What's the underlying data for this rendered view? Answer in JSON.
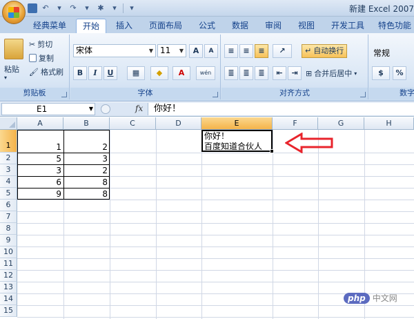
{
  "window": {
    "title": "新建 Excel 2007"
  },
  "tabs": [
    "经典菜单",
    "开始",
    "插入",
    "页面布局",
    "公式",
    "数据",
    "审阅",
    "视图",
    "开发工具",
    "特色功能"
  ],
  "active_tab": "开始",
  "ribbon": {
    "clipboard": {
      "paste": "粘贴",
      "cut": "剪切",
      "copy": "复制",
      "format_painter": "格式刷",
      "label": "剪贴板"
    },
    "font": {
      "name": "宋体",
      "size": "11",
      "label": "字体",
      "bold": "B",
      "italic": "I",
      "underline": "U",
      "grow": "A",
      "shrink": "A",
      "wen": "wén"
    },
    "alignment": {
      "wrap_text": "自动换行",
      "merge_center": "合并后居中",
      "label": "对齐方式"
    },
    "number": {
      "format": "常规",
      "label": "数字",
      "percent": "%"
    }
  },
  "formula_bar": {
    "name_box": "E1",
    "fx": "fx",
    "content": "你好！"
  },
  "columns": [
    "A",
    "B",
    "C",
    "D",
    "E",
    "F",
    "G",
    "H"
  ],
  "selected_column": "E",
  "rows": [
    "1",
    "2",
    "3",
    "4",
    "5",
    "6",
    "7",
    "8",
    "9",
    "10",
    "11",
    "12",
    "13",
    "14",
    "15"
  ],
  "cells": {
    "A": [
      "1",
      "5",
      "3",
      "6",
      "9"
    ],
    "B": [
      "2",
      "3",
      "2",
      "8",
      "8"
    ],
    "E1_line1": "你好！",
    "E1_line2": "百度知道合伙人"
  },
  "watermark": {
    "php": "php",
    "site": "中文网"
  },
  "colors": {
    "accent": "#f4b34a",
    "arrow": "#e8242c",
    "ribbon": "#d9e6f5"
  }
}
